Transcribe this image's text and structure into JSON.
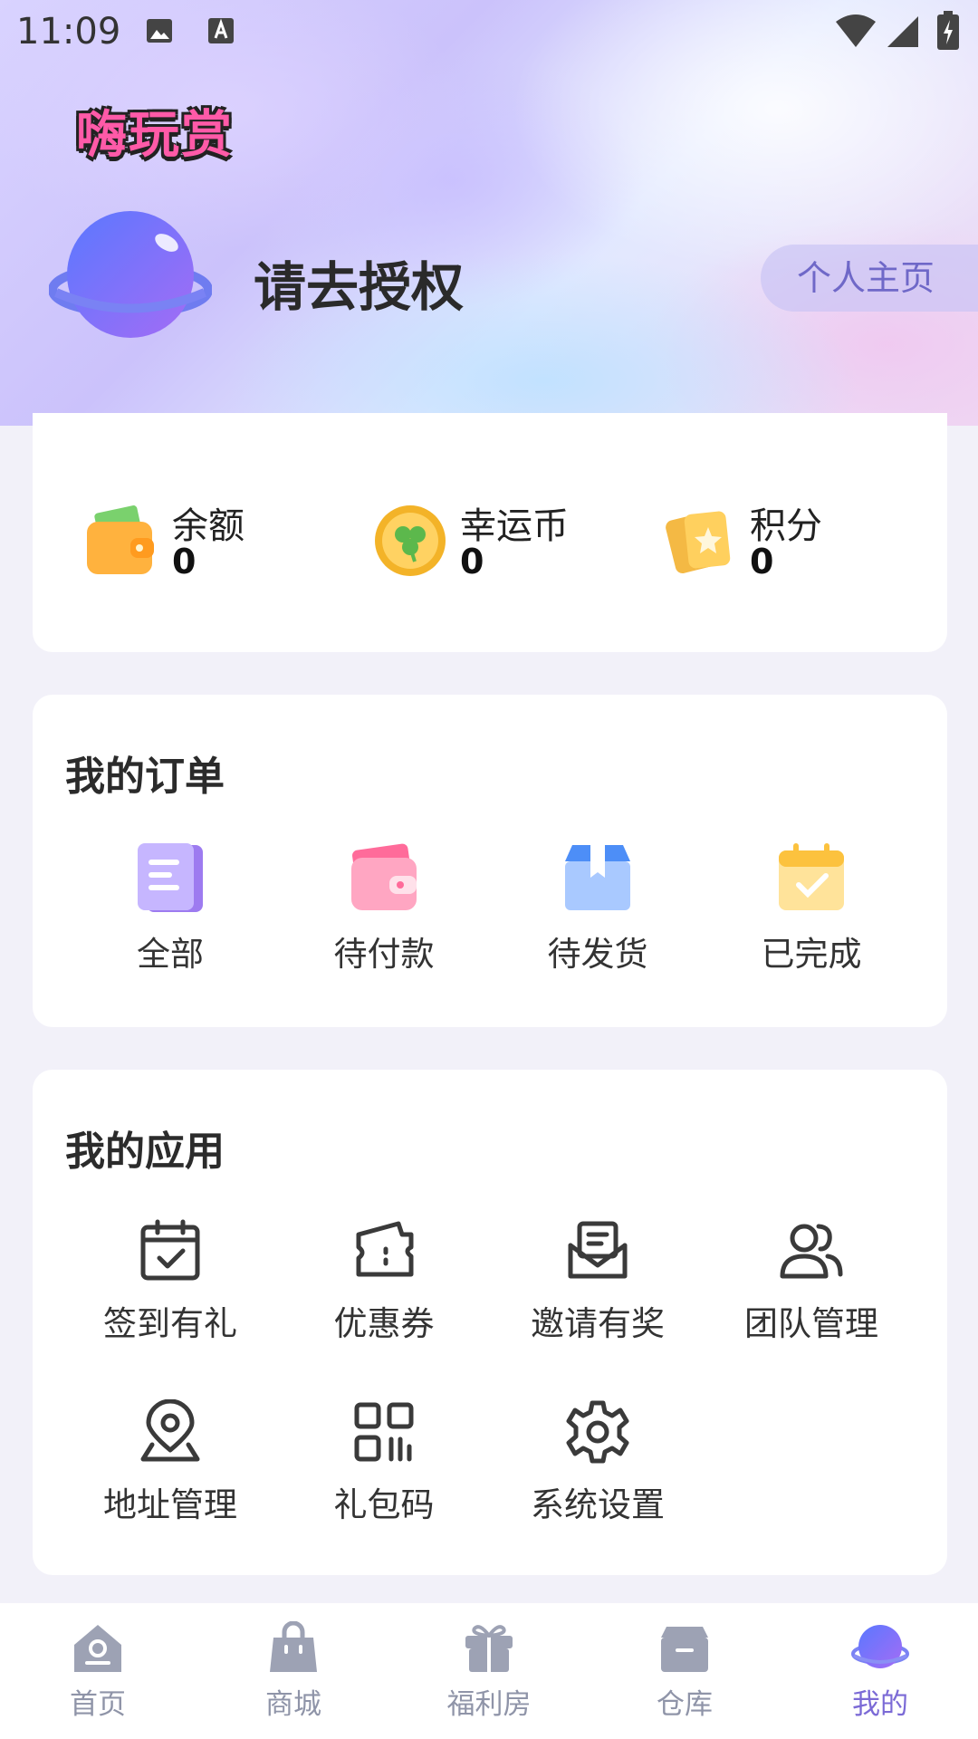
{
  "status_bar": {
    "time": "11:09"
  },
  "header": {
    "logo_text": "嗨玩赏",
    "auth_prompt": "请去授权",
    "profile_button": "个人主页"
  },
  "wallet": [
    {
      "label": "余额",
      "value": "0",
      "icon": "wallet-icon"
    },
    {
      "label": "幸运币",
      "value": "0",
      "icon": "coin-icon"
    },
    {
      "label": "积分",
      "value": "0",
      "icon": "points-cards-icon"
    }
  ],
  "orders": {
    "title": "我的订单",
    "items": [
      {
        "label": "全部",
        "icon": "document-icon"
      },
      {
        "label": "待付款",
        "icon": "wallet-pay-icon"
      },
      {
        "label": "待发货",
        "icon": "box-icon"
      },
      {
        "label": "已完成",
        "icon": "calendar-check-icon"
      }
    ]
  },
  "apps": {
    "title": "我的应用",
    "items": [
      {
        "label": "签到有礼",
        "icon": "calendar-check-icon"
      },
      {
        "label": "优惠券",
        "icon": "ticket-icon"
      },
      {
        "label": "邀请有奖",
        "icon": "mail-icon"
      },
      {
        "label": "团队管理",
        "icon": "users-icon"
      },
      {
        "label": "地址管理",
        "icon": "location-icon"
      },
      {
        "label": "礼包码",
        "icon": "qr-code-icon"
      },
      {
        "label": "系统设置",
        "icon": "gear-icon"
      }
    ]
  },
  "tabbar": {
    "items": [
      {
        "label": "首页",
        "icon": "home-icon"
      },
      {
        "label": "商城",
        "icon": "shopping-bag-icon"
      },
      {
        "label": "福利房",
        "icon": "gift-icon"
      },
      {
        "label": "仓库",
        "icon": "warehouse-box-icon"
      },
      {
        "label": "我的",
        "icon": "planet-icon"
      }
    ],
    "active": "我的",
    "active_color": "#7b6ad6",
    "inactive_color": "#8f94a8"
  }
}
